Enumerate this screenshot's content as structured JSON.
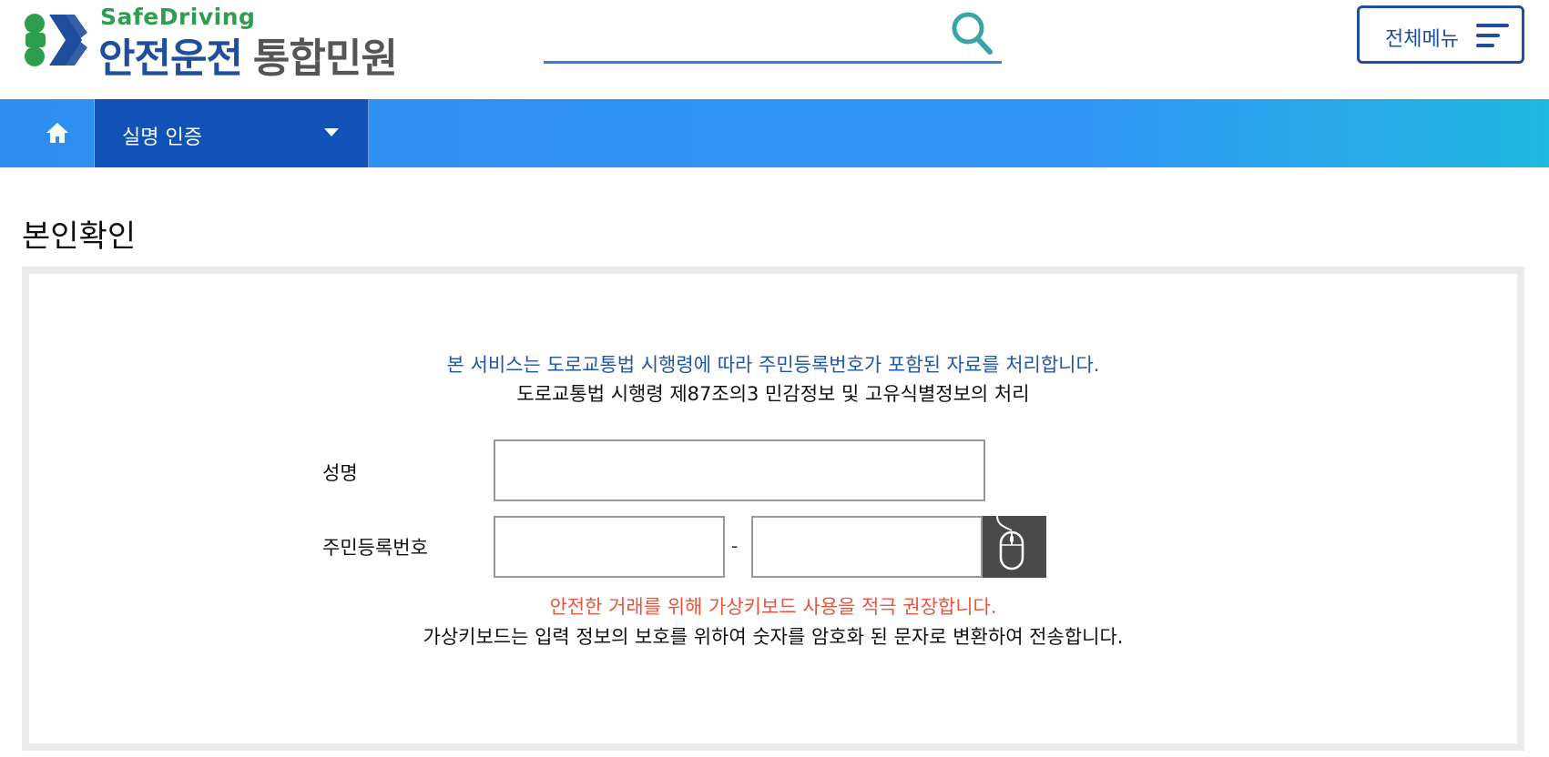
{
  "header": {
    "logo_sub": "SafeDriving",
    "logo_main": "안전운전",
    "logo_main_gray": "통합민원",
    "search_placeholder": "",
    "menu_label": "전체메뉴"
  },
  "nav": {
    "selected_label": "실명 인증"
  },
  "page": {
    "title": "본인확인"
  },
  "form": {
    "notice_blue": "본 서비스는 도로교통법 시행령에 따라 주민등록번호가 포함된 자료를 처리합니다.",
    "notice_black": "도로교통법 시행령 제87조의3 민감정보 및 고유식별정보의 처리",
    "name_label": "성명",
    "name_value": "",
    "rrn_label": "주민등록번호",
    "rrn_front_value": "",
    "rrn_dash": "-",
    "rrn_back_value": "",
    "warn_red": "안전한 거래를 위해 가상키보드 사용을 적극 권장합니다.",
    "warn_black": "가상키보드는 입력 정보의 보호를 위하여 숫자를 암호화 된 문자로 변환하여 전송합니다."
  },
  "colors": {
    "brand_blue": "#1f4e9c",
    "brand_green": "#2e9e4e",
    "nav_blue": "#2e8ff2",
    "nav_selected": "#1052b8",
    "notice_blue": "#1f57a8",
    "warn_red": "#e8553e"
  },
  "icons": {
    "logo": "clover-x-logo-icon",
    "search": "search-icon",
    "menu": "hamburger-icon",
    "home": "home-icon",
    "dropdown": "caret-down-icon",
    "virtual_keyboard": "mouse-icon"
  }
}
